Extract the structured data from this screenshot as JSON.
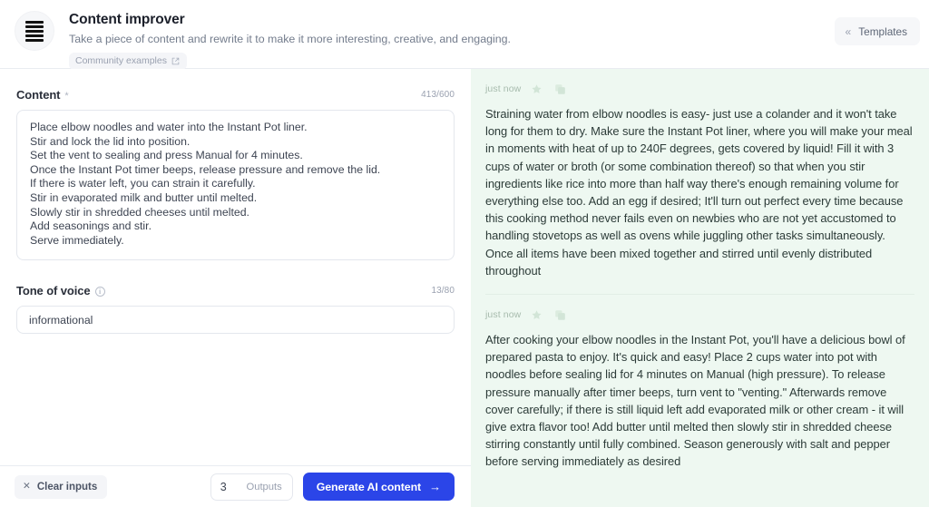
{
  "header": {
    "logo_icon": "stacked-bars-icon",
    "title": "Content improver",
    "subtitle": "Take a piece of content and rewrite it to make it more interesting, creative, and engaging.",
    "community_label": "Community examples",
    "community_icon": "external-link-icon",
    "templates_label": "Templates",
    "templates_icon": "chevron-double-left-icon",
    "templates_glyph": "«"
  },
  "form": {
    "content": {
      "label": "Content",
      "required_marker": "*",
      "counter": "413/600",
      "lines": [
        "Place elbow noodles and water into the Instant Pot liner.",
        "Stir and lock the lid into position.",
        "Set the vent to sealing and press Manual for 4 minutes.",
        "Once the Instant Pot timer beeps, release pressure and remove the lid.",
        "If there is water left, you can strain it carefully.",
        "Stir in evaporated milk and butter until melted.",
        "Slowly stir in shredded cheeses until melted.",
        "Add seasonings and stir.",
        "Serve immediately."
      ]
    },
    "tone": {
      "label": "Tone of voice",
      "info_icon": "info-circle-icon",
      "info_glyph": "i",
      "counter": "13/80",
      "value": "informational"
    }
  },
  "footer": {
    "clear_label": "Clear inputs",
    "clear_icon": "close-x-icon",
    "clear_glyph": "✕",
    "outputs_value": "3",
    "outputs_label": "Outputs",
    "generate_label": "Generate AI content",
    "generate_icon": "arrow-right-icon",
    "generate_glyph": "→",
    "generate_color": "#2b45e8"
  },
  "outputs": [
    {
      "time": "just now",
      "star_icon": "star-icon",
      "copy_icon": "copy-icon",
      "text": "Straining water from elbow noodles is easy- just use a colander and it won't take long for them to dry. Make sure the Instant Pot liner, where you will make your meal in moments with heat of up to 240F degrees, gets covered by liquid! Fill it with 3 cups of water or broth (or some combination thereof) so that when you stir ingredients like rice into more than half way there's enough remaining volume for everything else too. Add an egg if desired; It'll turn out perfect every time because this cooking method never fails even on newbies who are not yet accustomed to handling stovetops as well as ovens while juggling other tasks simultaneously. Once all items have been mixed together and stirred until evenly distributed throughout"
    },
    {
      "time": "just now",
      "star_icon": "star-icon",
      "copy_icon": "copy-icon",
      "text": "After cooking your elbow noodles in the Instant Pot, you'll have a delicious bowl of prepared pasta to enjoy. It's quick and easy! Place 2 cups water into pot with noodles before sealing lid for 4 minutes on Manual (high pressure). To release pressure manually after timer beeps, turn vent to \"venting.\" Afterwards remove cover carefully; if there is still liquid left add evaporated milk or other cream - it will give extra flavor too! Add butter until melted then slowly stir in shredded cheese stirring constantly until fully combined. Season generously with salt and pepper before serving immediately as desired"
    }
  ]
}
